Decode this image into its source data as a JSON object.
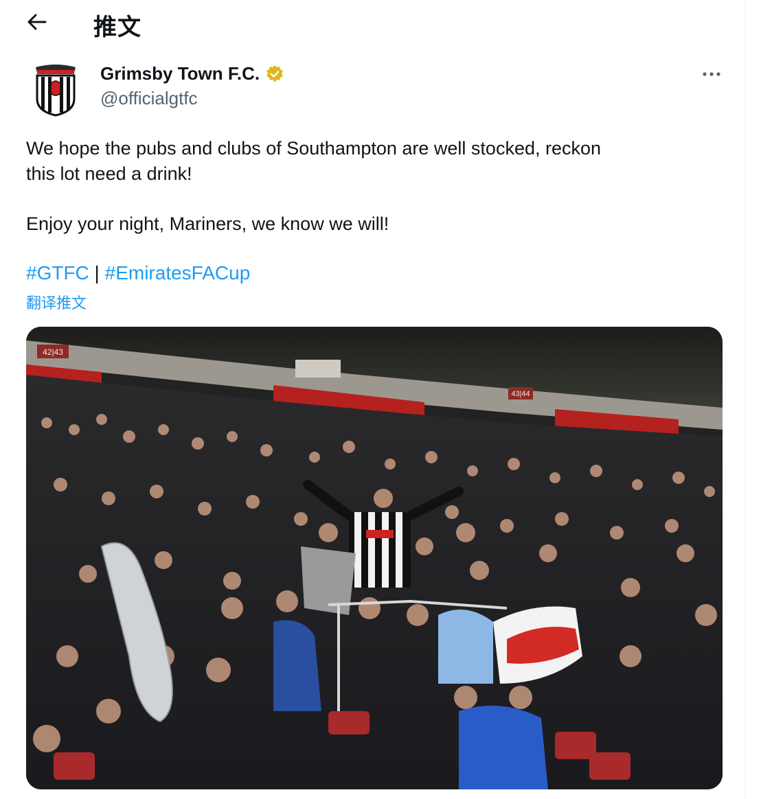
{
  "header": {
    "title": "推文"
  },
  "author": {
    "display_name": "Grimsby Town F.C.",
    "handle": "@officialgtfc"
  },
  "tweet": {
    "line1": "We hope the pubs and clubs of Southampton are well stocked, reckon",
    "line2": "this lot need a drink!",
    "paragraph2": "Enjoy your night, Mariners, we know we will!",
    "hashtags": [
      "#GTFC",
      "#EmiratesFACup"
    ],
    "hashtag_separator": " | ",
    "translate_label": "翻译推文"
  },
  "photo": {
    "stand_sign_left": "42|43",
    "stand_sign_right": "43|44"
  },
  "colors": {
    "link": "#1d9bf0",
    "verified": "#e2b719",
    "muted": "#536471"
  },
  "icons": {
    "back": "arrow-left-icon",
    "verified": "verified-badge-icon",
    "more": "more-horizontal-icon"
  }
}
